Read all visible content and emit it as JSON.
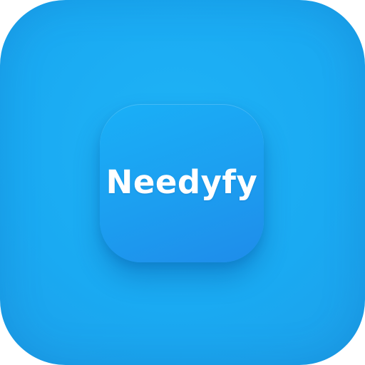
{
  "app": {
    "name": "Needyfy"
  },
  "colors": {
    "background": "#1aaaf2",
    "icon": "#1c9ef0",
    "text": "#ffffff"
  }
}
